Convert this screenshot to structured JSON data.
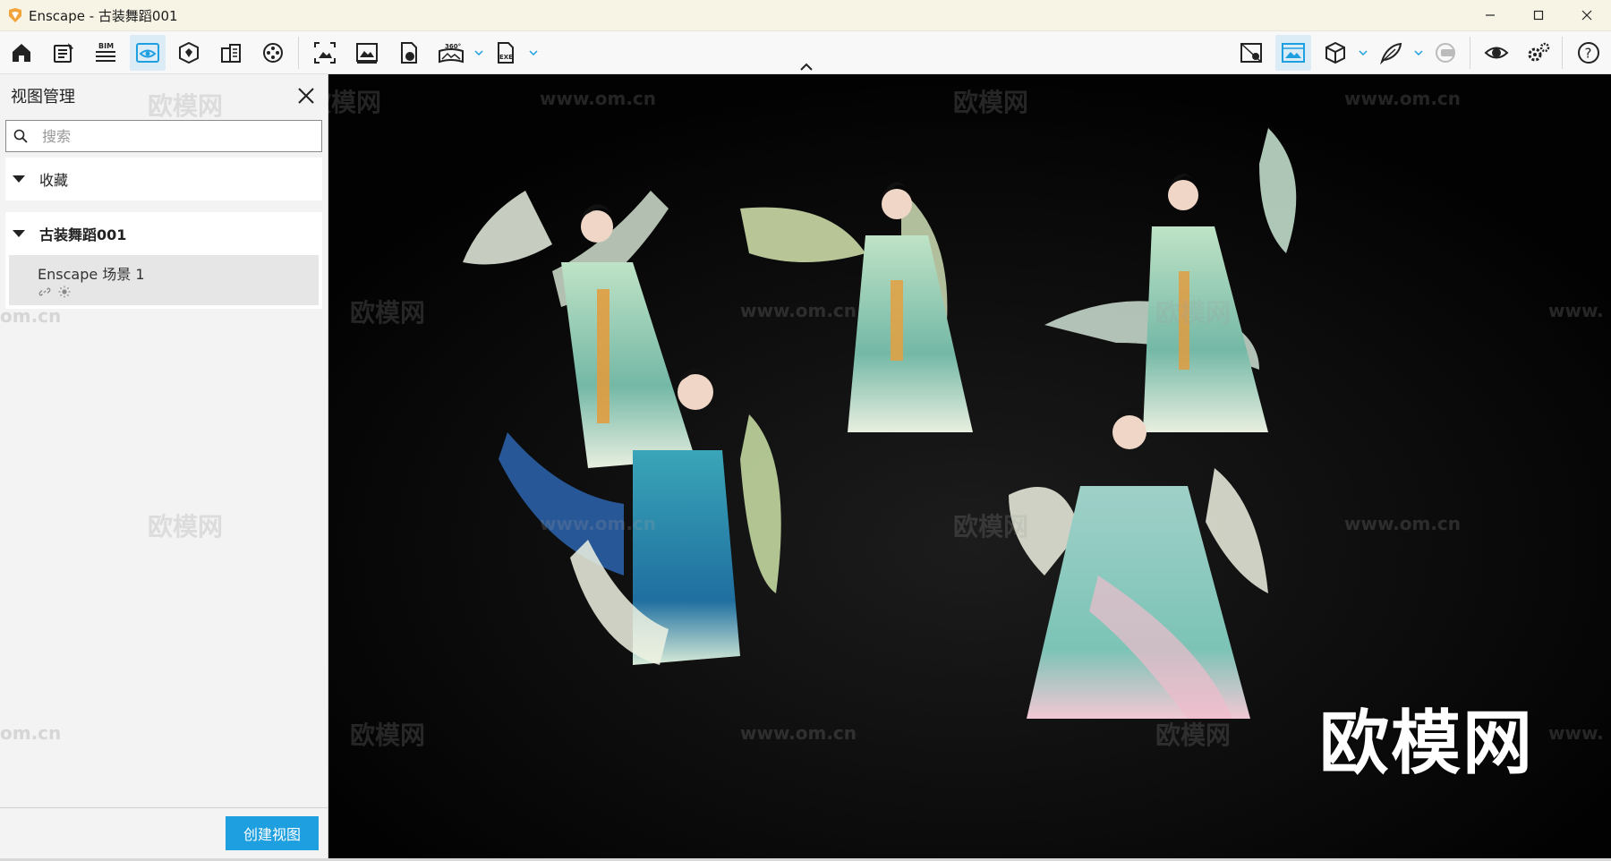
{
  "window": {
    "title": "Enscape - 古装舞蹈001",
    "minimize_icon": "minimize-icon",
    "maximize_icon": "maximize-icon",
    "close_icon": "close-icon"
  },
  "toolbar": {
    "left_buttons": [
      {
        "name": "home",
        "icon": "home-icon"
      },
      {
        "name": "notes",
        "icon": "notes-icon"
      },
      {
        "name": "bim",
        "icon": "bim-icon",
        "label": "BIM"
      },
      {
        "name": "view-management",
        "icon": "eye-frame-icon",
        "active": true
      },
      {
        "name": "asset-library",
        "icon": "asset-library-icon"
      },
      {
        "name": "material-editor",
        "icon": "building-icon"
      },
      {
        "name": "video-editor",
        "icon": "film-reel-icon"
      },
      {
        "name": "screenshot",
        "icon": "screenshot-icon"
      },
      {
        "name": "batch-render",
        "icon": "image-icon"
      },
      {
        "name": "web-standalone",
        "icon": "file-globe-icon"
      },
      {
        "name": "panorama",
        "icon": "panorama-icon",
        "label": "360°"
      },
      {
        "name": "export-exe",
        "icon": "exe-file-icon",
        "label": "EXE"
      }
    ],
    "right_buttons": [
      {
        "name": "map",
        "icon": "map-icon"
      },
      {
        "name": "visual-settings",
        "icon": "landscape-icon",
        "active": true
      },
      {
        "name": "box",
        "icon": "cube-icon"
      },
      {
        "name": "vr",
        "icon": "feather-icon"
      },
      {
        "name": "vr-headset",
        "icon": "vr-headset-icon"
      },
      {
        "name": "view",
        "icon": "eye-icon"
      },
      {
        "name": "settings",
        "icon": "gears-icon"
      },
      {
        "name": "help",
        "icon": "help-icon"
      }
    ]
  },
  "panel": {
    "title": "视图管理",
    "search": {
      "placeholder": "搜索",
      "value": ""
    },
    "favorites": {
      "label": "收藏"
    },
    "project": {
      "label": "古装舞蹈001",
      "views": [
        {
          "label": "Enscape 场景 1",
          "icons": [
            "link-icon",
            "sun-icon"
          ]
        }
      ]
    },
    "create_button": "创建视图"
  },
  "viewport": {
    "watermark_large": "欧模网",
    "watermark_small": "欧模网",
    "watermark_url": "www.om.cn",
    "watermark_fragment": "om.cn",
    "watermark_url_fragment": "www."
  },
  "colors": {
    "accent": "#1e9fe0",
    "active_button": "#dcecf7",
    "logo_orange": "#f2a33a"
  }
}
